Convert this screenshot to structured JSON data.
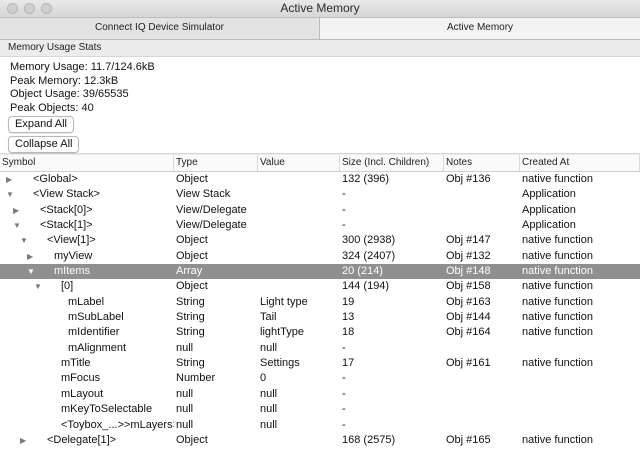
{
  "window": {
    "title": "Active Memory"
  },
  "tabs": [
    {
      "label": "Connect IQ Device Simulator"
    },
    {
      "label": "Active Memory"
    }
  ],
  "stats": {
    "group_label": "Memory Usage Stats",
    "memory_usage": "Memory Usage: 11.7/124.6kB",
    "peak_memory": "Peak Memory: 12.3kB",
    "object_usage": "Object Usage: 39/65535",
    "peak_objects": "Peak Objects: 40",
    "expand_all": "Expand All",
    "collapse_all": "Collapse All"
  },
  "table": {
    "columns": [
      "Symbol",
      "Type",
      "Value",
      "Size (Incl. Children)",
      "Notes",
      "Created At"
    ],
    "rows": [
      {
        "depth": 0,
        "toggle": "collapsed",
        "symbol": "<Global>",
        "type": "Object",
        "value": "",
        "size": "132 (396)",
        "notes": "Obj #136",
        "created": "native function",
        "selected": false
      },
      {
        "depth": 0,
        "toggle": "expanded",
        "symbol": "<View Stack>",
        "type": "View Stack",
        "value": "",
        "size": "-",
        "notes": "",
        "created": "Application",
        "selected": false
      },
      {
        "depth": 1,
        "toggle": "collapsed",
        "symbol": "<Stack[0]>",
        "type": "View/Delegate",
        "value": "",
        "size": "-",
        "notes": "",
        "created": "Application",
        "selected": false
      },
      {
        "depth": 1,
        "toggle": "expanded",
        "symbol": "<Stack[1]>",
        "type": "View/Delegate",
        "value": "",
        "size": "-",
        "notes": "",
        "created": "Application",
        "selected": false
      },
      {
        "depth": 2,
        "toggle": "expanded",
        "symbol": "<View[1]>",
        "type": "Object",
        "value": "",
        "size": "300 (2938)",
        "notes": "Obj #147",
        "created": "native function",
        "selected": false
      },
      {
        "depth": 3,
        "toggle": "collapsed",
        "symbol": "myView",
        "type": "Object",
        "value": "",
        "size": "324 (2407)",
        "notes": "Obj #132",
        "created": "native function",
        "selected": false
      },
      {
        "depth": 3,
        "toggle": "expanded",
        "symbol": "mItems",
        "type": "Array",
        "value": "",
        "size": "20 (214)",
        "notes": "Obj #148",
        "created": "native function",
        "selected": true
      },
      {
        "depth": 4,
        "toggle": "expanded",
        "symbol": "[0]",
        "type": "Object",
        "value": "",
        "size": "144 (194)",
        "notes": "Obj #158",
        "created": "native function",
        "selected": false
      },
      {
        "depth": 5,
        "toggle": "none",
        "symbol": "mLabel",
        "type": "String",
        "value": "Light type",
        "size": "19",
        "notes": "Obj #163",
        "created": "native function",
        "selected": false
      },
      {
        "depth": 5,
        "toggle": "none",
        "symbol": "mSubLabel",
        "type": "String",
        "value": "Tail",
        "size": "13",
        "notes": "Obj #144",
        "created": "native function",
        "selected": false
      },
      {
        "depth": 5,
        "toggle": "none",
        "symbol": "mIdentifier",
        "type": "String",
        "value": "lightType",
        "size": "18",
        "notes": "Obj #164",
        "created": "native function",
        "selected": false
      },
      {
        "depth": 5,
        "toggle": "none",
        "symbol": "mAlignment",
        "type": "null",
        "value": "null",
        "size": "-",
        "notes": "",
        "created": "",
        "selected": false
      },
      {
        "depth": 4,
        "toggle": "none",
        "symbol": "mTitle",
        "type": "String",
        "value": "Settings",
        "size": "17",
        "notes": "Obj #161",
        "created": "native function",
        "selected": false
      },
      {
        "depth": 4,
        "toggle": "none",
        "symbol": "mFocus",
        "type": "Number",
        "value": "0",
        "size": "-",
        "notes": "",
        "created": "",
        "selected": false
      },
      {
        "depth": 4,
        "toggle": "none",
        "symbol": "mLayout",
        "type": "null",
        "value": "null",
        "size": "-",
        "notes": "",
        "created": "",
        "selected": false
      },
      {
        "depth": 4,
        "toggle": "none",
        "symbol": "mKeyToSelectable",
        "type": "null",
        "value": "null",
        "size": "-",
        "notes": "",
        "created": "",
        "selected": false
      },
      {
        "depth": 4,
        "toggle": "none",
        "symbol": "<Toybox_...>>mLayers>",
        "type": "null",
        "value": "null",
        "size": "-",
        "notes": "",
        "created": "",
        "selected": false
      },
      {
        "depth": 2,
        "toggle": "collapsed",
        "symbol": "<Delegate[1]>",
        "type": "Object",
        "value": "",
        "size": "168 (2575)",
        "notes": "Obj #165",
        "created": "native function",
        "selected": false
      }
    ]
  }
}
